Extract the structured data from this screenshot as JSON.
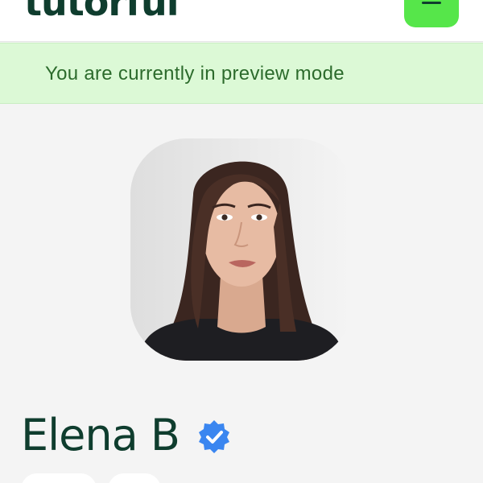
{
  "header": {
    "logo_text": "tutorful",
    "menu_icon": "hamburger-menu-icon",
    "accent_color": "#56e64a",
    "brand_color": "#0f3d2e"
  },
  "banner": {
    "text": "You are currently in preview mode",
    "background": "#dcf9d6"
  },
  "profile": {
    "name": "Elena B",
    "verified_icon": "verified-badge-icon",
    "verified_color": "#3a86f0"
  }
}
